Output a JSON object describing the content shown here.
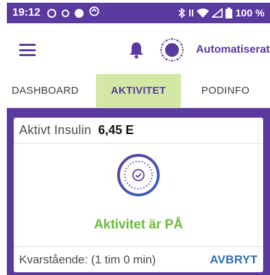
{
  "status_bar": {
    "time": "19:12",
    "battery": "100 %",
    "icons": [
      "record-icon",
      "info-icon",
      "dot-icon",
      "sync-icon",
      "bluetooth-icon",
      "vibrate-icon",
      "wifi-icon",
      "signal-icon",
      "battery-icon"
    ]
  },
  "app_bar": {
    "menu_icon": "hamburger-icon",
    "bell_icon": "bell-icon",
    "pod_icon": "pod-status-icon",
    "mode_label": "Automatiserat"
  },
  "tabs": [
    {
      "label": "DASHBOARD",
      "active": false
    },
    {
      "label": "AKTIVITET",
      "active": true
    },
    {
      "label": "PODINFO",
      "active": false
    }
  ],
  "card": {
    "insulin_label": "Aktivt Insulin",
    "insulin_value": "6,45 E",
    "activity_status": "Aktivitet är PÅ",
    "remaining": "Kvarstående: (1 tim 0 min)",
    "cancel_label": "AVBRYT"
  },
  "colors": {
    "brand_purple": "#5a3a9e",
    "active_tab_bg": "#d4e8a6",
    "status_green": "#6dbb3a",
    "link_blue": "#2f6fb7"
  }
}
